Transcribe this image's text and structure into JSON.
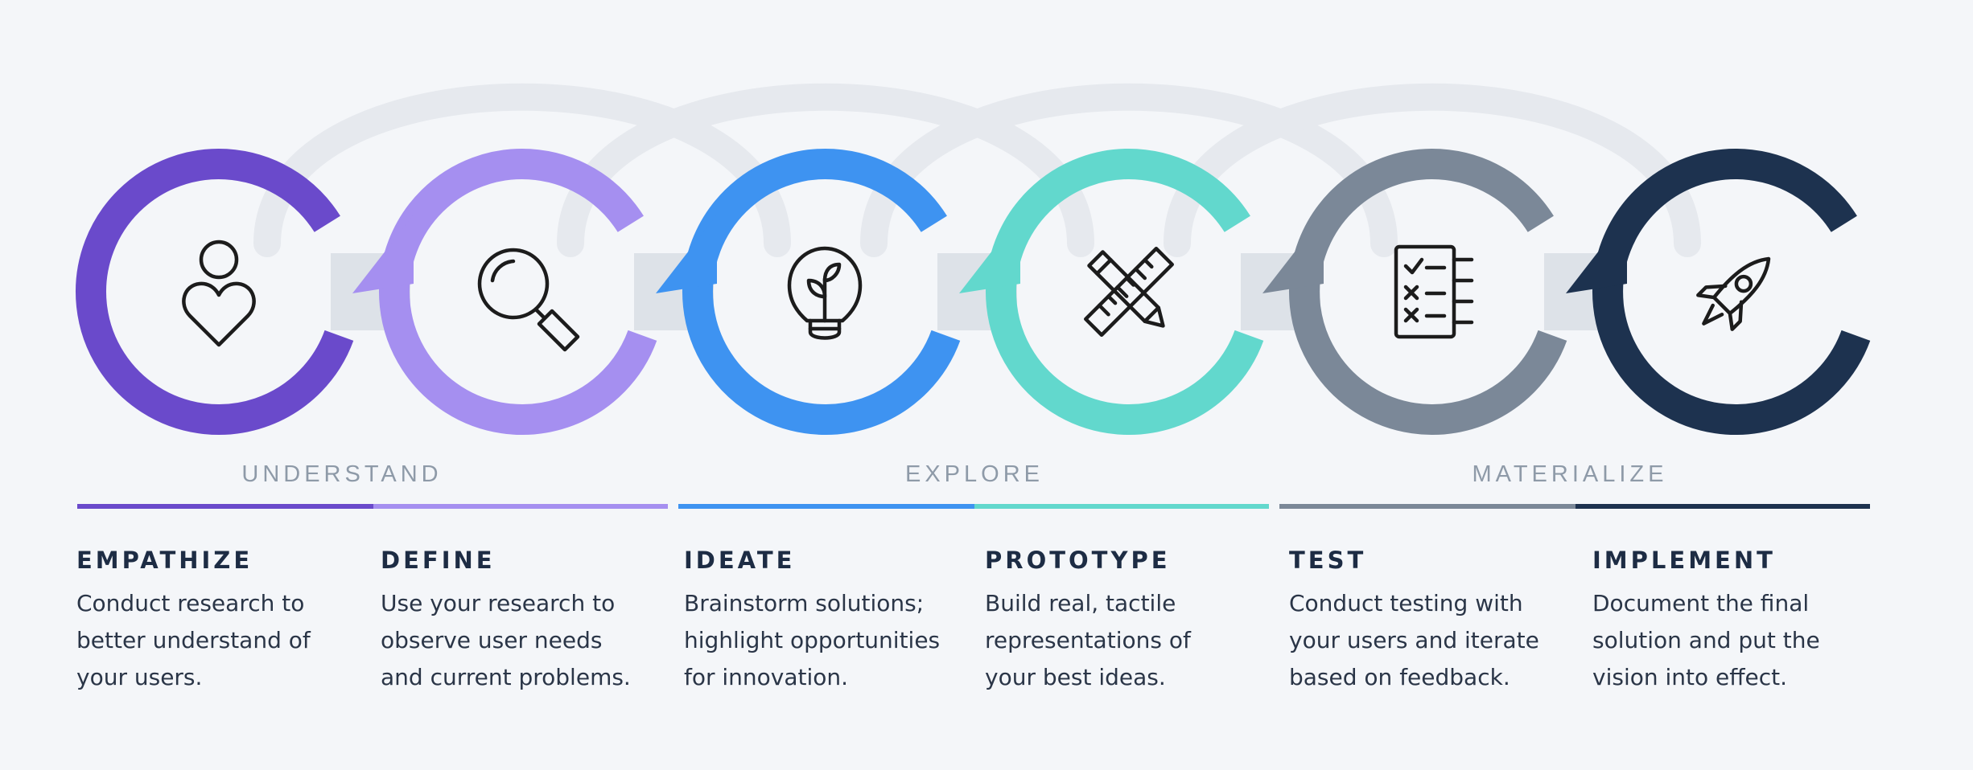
{
  "groups": [
    {
      "label": "UNDERSTAND"
    },
    {
      "label": "EXPLORE"
    },
    {
      "label": "MATERIALIZE"
    }
  ],
  "stages": [
    {
      "title": "EMPATHIZE",
      "desc": [
        "Conduct research to",
        "better understand of",
        "your users."
      ],
      "color": "#6a4acb",
      "icon": "person-heart-icon"
    },
    {
      "title": "DEFINE",
      "desc": [
        "Use your research to",
        "observe user needs",
        "and current problems."
      ],
      "color": "#a58ff0",
      "icon": "magnifier-icon"
    },
    {
      "title": "IDEATE",
      "desc": [
        "Brainstorm solutions;",
        "highlight opportunities",
        "for innovation."
      ],
      "color": "#3e93f1",
      "icon": "lightbulb-icon"
    },
    {
      "title": "PROTOTYPE",
      "desc": [
        "Build real, tactile",
        "representations of",
        "your best ideas."
      ],
      "color": "#62d8cd",
      "icon": "ruler-pencil-icon"
    },
    {
      "title": "TEST",
      "desc": [
        "Conduct testing with",
        "your users and iterate",
        "based on feedback."
      ],
      "color": "#7b8898",
      "icon": "checklist-icon"
    },
    {
      "title": "IMPLEMENT",
      "desc": [
        "Document the final",
        "solution and put the",
        "vision into effect."
      ],
      "color": "#1d324f",
      "icon": "rocket-icon"
    }
  ],
  "colors": {
    "background": "#f4f6f9",
    "loop": "#e6e9ee",
    "icon_stroke": "#1c1c1c"
  }
}
